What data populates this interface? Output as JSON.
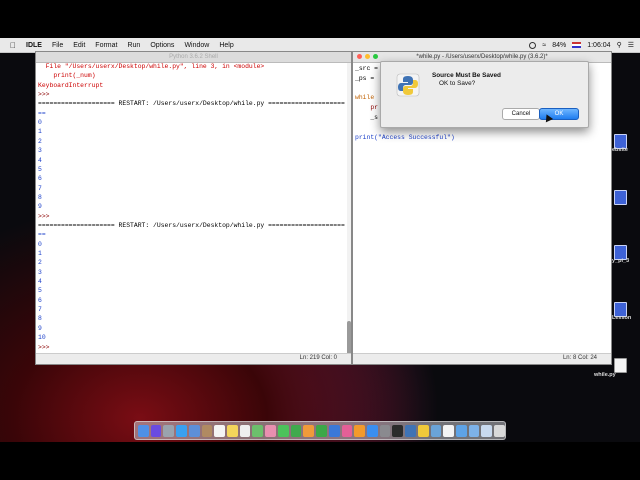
{
  "menubar": {
    "items": [
      "IDLE",
      "File",
      "Edit",
      "Format",
      "Run",
      "Options",
      "Window",
      "Help"
    ],
    "battery": "84%",
    "time": "1:06:04"
  },
  "shell": {
    "title": "Python 3.6.2 Shell",
    "lines": [
      {
        "text": "  File \"/Users/userx/Desktop/while.py\", line 3, in <module>",
        "cls": "red"
      },
      {
        "text": "    print(_num)",
        "cls": "red"
      },
      {
        "text": "KeyboardInterrupt",
        "cls": "red"
      },
      {
        "text": ">>> ",
        "cls": "maroon"
      },
      {
        "text": "==================== RESTART: /Users/userx/Desktop/while.py ====================",
        "cls": ""
      },
      {
        "text": "==",
        "cls": "blue"
      },
      {
        "text": "0",
        "cls": "blue"
      },
      {
        "text": "1",
        "cls": "blue"
      },
      {
        "text": "2",
        "cls": "blue"
      },
      {
        "text": "3",
        "cls": "blue"
      },
      {
        "text": "4",
        "cls": "blue"
      },
      {
        "text": "5",
        "cls": "blue"
      },
      {
        "text": "6",
        "cls": "blue"
      },
      {
        "text": "7",
        "cls": "blue"
      },
      {
        "text": "8",
        "cls": "blue"
      },
      {
        "text": "9",
        "cls": "blue"
      },
      {
        "text": ">>> ",
        "cls": "maroon"
      },
      {
        "text": "==================== RESTART: /Users/userx/Desktop/while.py ====================",
        "cls": ""
      },
      {
        "text": "==",
        "cls": "blue"
      },
      {
        "text": "0",
        "cls": "blue"
      },
      {
        "text": "1",
        "cls": "blue"
      },
      {
        "text": "2",
        "cls": "blue"
      },
      {
        "text": "3",
        "cls": "blue"
      },
      {
        "text": "4",
        "cls": "blue"
      },
      {
        "text": "5",
        "cls": "blue"
      },
      {
        "text": "6",
        "cls": "blue"
      },
      {
        "text": "7",
        "cls": "blue"
      },
      {
        "text": "8",
        "cls": "blue"
      },
      {
        "text": "9",
        "cls": "blue"
      },
      {
        "text": "10",
        "cls": "blue"
      },
      {
        "text": ">>> ",
        "cls": "maroon"
      }
    ],
    "status": "Ln: 219  Col: 0"
  },
  "editor": {
    "title": "*while.py - /Users/userx/Desktop/while.py (3.6.2)*",
    "lines": [
      {
        "text": "_src =",
        "cls": ""
      },
      {
        "text": "_ps =",
        "cls": ""
      },
      {
        "text": "",
        "cls": ""
      },
      {
        "text": "while",
        "cls": "orange"
      },
      {
        "text": "    pr",
        "cls": "maroon"
      },
      {
        "text": "    _s",
        "cls": ""
      },
      {
        "text": "",
        "cls": ""
      },
      {
        "text": "print(\"Access Successful\")",
        "cls": "blue"
      }
    ],
    "status": "Ln: 8  Col: 24"
  },
  "dialog": {
    "heading": "Source Must Be Saved",
    "message": "OK to Save?",
    "cancel_label": "Cancel",
    "ok_label": "OK"
  },
  "desktop_icons": [
    "ebsite",
    "y_pi_3",
    "Lesson",
    "while.py"
  ]
}
